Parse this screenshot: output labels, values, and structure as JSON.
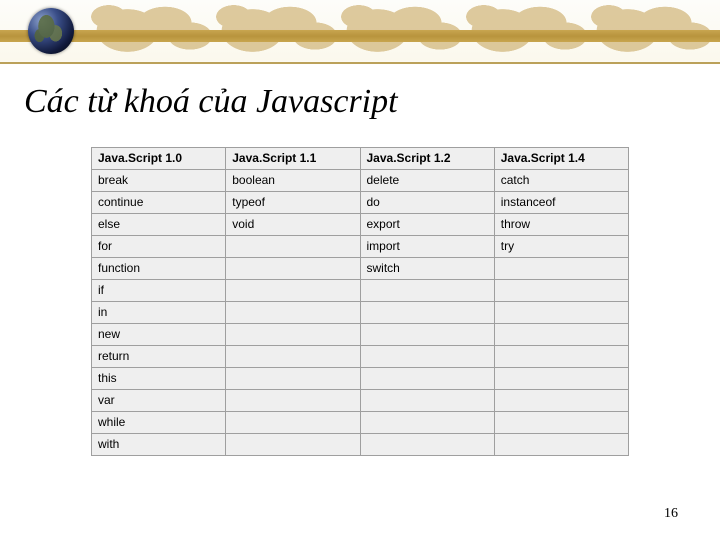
{
  "title": "Các từ khoá của Javascript",
  "page_number": "16",
  "table": {
    "headers": [
      "Java.Script 1.0",
      "Java.Script 1.1",
      "Java.Script 1.2",
      "Java.Script 1.4"
    ],
    "rows": [
      [
        "break",
        "boolean",
        "delete",
        "catch"
      ],
      [
        "continue",
        "typeof",
        "do",
        "instanceof"
      ],
      [
        "else",
        "void",
        "export",
        "throw"
      ],
      [
        "for",
        "",
        "import",
        "try"
      ],
      [
        "function",
        "",
        "switch",
        ""
      ],
      [
        "if",
        "",
        "",
        ""
      ],
      [
        "in",
        "",
        "",
        ""
      ],
      [
        "new",
        "",
        "",
        ""
      ],
      [
        "return",
        "",
        "",
        ""
      ],
      [
        "this",
        "",
        "",
        ""
      ],
      [
        "var",
        "",
        "",
        ""
      ],
      [
        "while",
        "",
        "",
        ""
      ],
      [
        "with",
        "",
        "",
        ""
      ]
    ]
  }
}
